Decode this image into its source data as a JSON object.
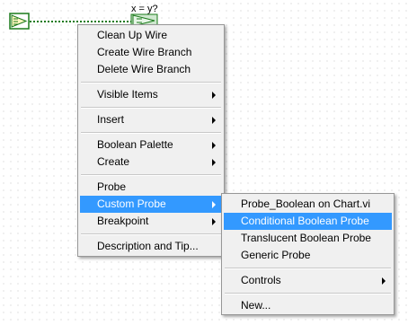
{
  "diagram": {
    "compare_label": "x = y?"
  },
  "context_menu": {
    "groups": [
      [
        "Clean Up Wire",
        "Create Wire Branch",
        "Delete Wire Branch"
      ],
      [
        "Visible Items"
      ],
      [
        "Insert"
      ],
      [
        "Boolean Palette",
        "Create"
      ],
      [
        "Probe",
        "Custom Probe",
        "Breakpoint"
      ],
      [
        "Description and Tip..."
      ]
    ],
    "items": {
      "clean_up_wire": "Clean Up Wire",
      "create_wire_branch": "Create Wire Branch",
      "delete_wire_branch": "Delete Wire Branch",
      "visible_items": "Visible Items",
      "insert": "Insert",
      "boolean_palette": "Boolean Palette",
      "create": "Create",
      "probe": "Probe",
      "custom_probe": "Custom Probe",
      "breakpoint": "Breakpoint",
      "description_and_tip": "Description and Tip..."
    },
    "highlighted": "Custom Probe"
  },
  "submenu": {
    "items": {
      "probe_boolean_on_chart": "Probe_Boolean on Chart.vi",
      "conditional_boolean_probe": "Conditional Boolean Probe",
      "translucent_boolean_probe": "Translucent Boolean Probe",
      "generic_probe": "Generic Probe",
      "controls": "Controls",
      "new": "New..."
    },
    "highlighted": "Conditional Boolean Probe"
  },
  "colors": {
    "highlight": "#3399ff",
    "wire_boolean": "#1a7a1a",
    "menu_background": "#f0f0f0"
  }
}
